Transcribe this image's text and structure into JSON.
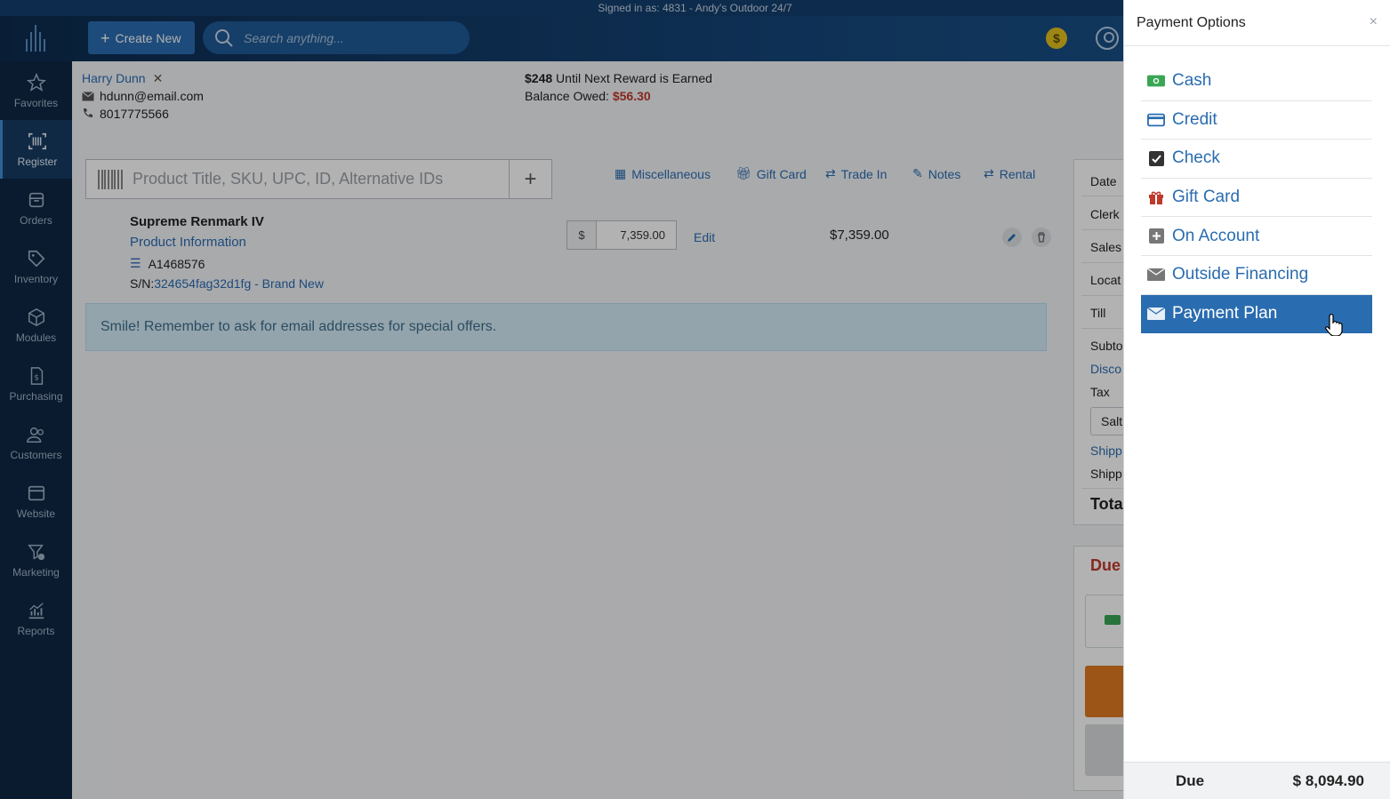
{
  "signed_in": "Signed in as: 4831 - Andy's Outdoor 24/7",
  "topbar": {
    "create_label": "Create New",
    "search_placeholder": "Search anything..."
  },
  "sidebar": {
    "items": [
      {
        "label": "Favorites",
        "icon": "star-icon"
      },
      {
        "label": "Register",
        "icon": "barcode-icon",
        "active": true
      },
      {
        "label": "Orders",
        "icon": "box-icon"
      },
      {
        "label": "Inventory",
        "icon": "tag-icon"
      },
      {
        "label": "Modules",
        "icon": "cube-icon"
      },
      {
        "label": "Purchasing",
        "icon": "invoice-icon"
      },
      {
        "label": "Customers",
        "icon": "users-icon"
      },
      {
        "label": "Website",
        "icon": "browser-icon"
      },
      {
        "label": "Marketing",
        "icon": "funnel-icon"
      },
      {
        "label": "Reports",
        "icon": "chart-icon"
      }
    ]
  },
  "customer": {
    "name": "Harry Dunn",
    "email": "hdunn@email.com",
    "phone": "8017775566"
  },
  "rewards": {
    "amount": "$248",
    "text": " Until Next Reward is Earned",
    "balance_label": "Balance Owed: ",
    "balance_value": "$56.30"
  },
  "scan": {
    "placeholder": "Product Title, SKU, UPC, ID, Alternative IDs"
  },
  "quick_links": [
    "Miscellaneous",
    "Gift Card",
    "Trade In",
    "Notes",
    "Rental"
  ],
  "line_item": {
    "title": "Supreme Renmark IV",
    "info_link": "Product Information",
    "sku": "A1468576",
    "sn_label": "S/N:",
    "sn_value": "324654fag32d1fg - Brand New",
    "currency": "$",
    "price": "7,359.00",
    "edit_label": "Edit",
    "total": "$7,359.00"
  },
  "tip": "Smile! Remember to ask for email addresses for special offers.",
  "summary_rows": {
    "date": "Date",
    "clerk": "Clerk",
    "sales": "Sales",
    "location": "Locat",
    "till": "Till",
    "subtotal": "Subto",
    "discount": "Disco",
    "tax": "Tax",
    "tax_select": "Salt",
    "shipping1": "Shipp",
    "shipping2": "Shipp",
    "total": "Tota",
    "due": "Due"
  },
  "panel": {
    "title": "Payment Options",
    "close": "×",
    "options": [
      {
        "label": "Cash",
        "icon": "cash-icon"
      },
      {
        "label": "Credit",
        "icon": "credit-card-icon"
      },
      {
        "label": "Check",
        "icon": "checkbox-icon"
      },
      {
        "label": "Gift Card",
        "icon": "gift-icon"
      },
      {
        "label": "On Account",
        "icon": "plus-square-icon"
      },
      {
        "label": "Outside Financing",
        "icon": "envelope-icon"
      },
      {
        "label": "Payment Plan",
        "icon": "envelope-icon",
        "selected": true
      }
    ],
    "due_label": "Due",
    "due_value": "$ 8,094.90"
  },
  "colors": {
    "accent": "#2a6cb0",
    "sidebar": "#0f2844",
    "danger": "#c0392b",
    "gift": "#c0392b",
    "cash": "#3aa655"
  }
}
